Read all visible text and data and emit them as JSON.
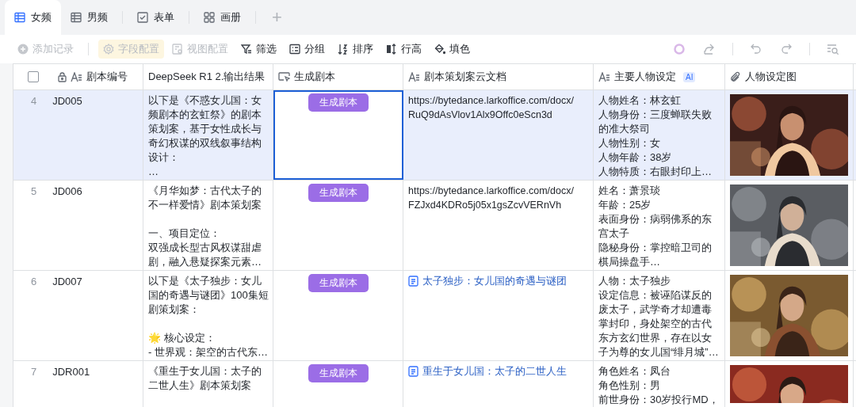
{
  "tabs": [
    {
      "label": "女频",
      "selected": true
    },
    {
      "label": "男频",
      "selected": false
    },
    {
      "label": "表单",
      "selected": false
    },
    {
      "label": "画册",
      "selected": false
    }
  ],
  "add_tab": "+",
  "toolbar": [
    {
      "label": "添加记录",
      "disabled": true,
      "highlighted": false
    },
    {
      "label": "字段配置",
      "disabled": true,
      "highlighted": true
    },
    {
      "label": "视图配置",
      "disabled": true,
      "highlighted": false
    },
    {
      "label": "筛选",
      "disabled": false,
      "highlighted": false
    },
    {
      "label": "分组",
      "disabled": false,
      "highlighted": false
    },
    {
      "label": "排序",
      "disabled": false,
      "highlighted": false
    },
    {
      "label": "行高",
      "disabled": false,
      "highlighted": false
    },
    {
      "label": "填色",
      "disabled": false,
      "highlighted": false
    }
  ],
  "table": {
    "select_all": {
      "checked": false
    },
    "columns": [
      {
        "label": "剧本编号",
        "locked": true
      },
      {
        "label": "DeepSeek R1 2.输出结果",
        "locked": false
      },
      {
        "label": "生成剧本",
        "locked": false
      },
      {
        "label": "剧本策划案云文档",
        "locked": false
      },
      {
        "label": "主要人物设定",
        "locked": false,
        "badge": "AI"
      },
      {
        "label": "人物设定图",
        "locked": false
      }
    ],
    "rows": [
      {
        "number": "4",
        "id": "JD005",
        "selected": true,
        "button_cell_focused": true,
        "output": [
          {
            "text": "以下是《不惑女儿国：女频剧本的玄虹祭》的剧本策划案，基于女性成长与奇幻权谋的双线叙事结构设计：",
            "spaced": false
          },
          {
            "text": "…",
            "spaced": false
          }
        ],
        "button": "生成剧本",
        "doc": {
          "kind": "url",
          "text": "https://bytedance.larkoffice.com/docx/\nRuQ9dAsVlov1Alx9Offc0eScn3d"
        },
        "characters": [
          "人物姓名：林玄虹",
          "人物身份：三度蝉联失败的准大祭司",
          "人物性别：女",
          "人物年龄：38岁",
          "人物特质：右眼封印上…"
        ],
        "image": {
          "kind": "picture"
        }
      },
      {
        "number": "5",
        "id": "JD006",
        "selected": false,
        "button_cell_focused": false,
        "output": [
          {
            "text": "《月华如梦：古代太子的不一样爱情》剧本策划案",
            "spaced": false
          },
          {
            "text": "一、项目定位：",
            "spaced": true
          },
          {
            "text": "双强成长型古风权谋甜虐剧，融入悬疑探案元素…",
            "spaced": false
          }
        ],
        "button": "生成剧本",
        "doc": {
          "kind": "url",
          "text": "https://bytedance.larkoffice.com/docx/\nFZJxd4KDRo5j05x1gsZcvVERnVh"
        },
        "characters": [
          "姓名：萧景琰",
          "年龄：25岁",
          "表面身份：病弱佛系的东宫太子",
          "隐秘身份：掌控暗卫司的棋局操盘手…"
        ],
        "image": {
          "kind": "picture"
        }
      },
      {
        "number": "6",
        "id": "JD007",
        "selected": false,
        "button_cell_focused": false,
        "output": [
          {
            "text": "以下是《太子独步：女儿国的奇遇与谜团》100集短剧策划案：",
            "spaced": false
          },
          {
            "text": "🌟 核心设定：",
            "spaced": true
          },
          {
            "text": "- 世界观：架空的古代东…",
            "spaced": false
          }
        ],
        "button": "生成剧本",
        "doc": {
          "kind": "doc",
          "text": "太子独步：女儿国的奇遇与谜团"
        },
        "characters": [
          "人物：太子独步",
          "设定信息：被诬陷谋反的废太子，武学奇才却遭毒掌封印，身处架空的古代东方玄幻世界，存在以女子为尊的女儿国“绯月城”…"
        ],
        "image": {
          "kind": "picture"
        }
      },
      {
        "number": "7",
        "id": "JDR001",
        "selected": false,
        "button_cell_focused": false,
        "output": [
          {
            "text": "《重生于女儿国：太子的二世人生》剧本策划案",
            "spaced": false
          }
        ],
        "button": "生成剧本",
        "doc": {
          "kind": "doc",
          "text": "重生于女儿国：太子的二世人生"
        },
        "characters": [
          "角色姓名：凤台",
          "角色性别：男",
          "前世身份：30岁投行MD，"
        ],
        "image": {
          "kind": "picture"
        }
      }
    ]
  }
}
